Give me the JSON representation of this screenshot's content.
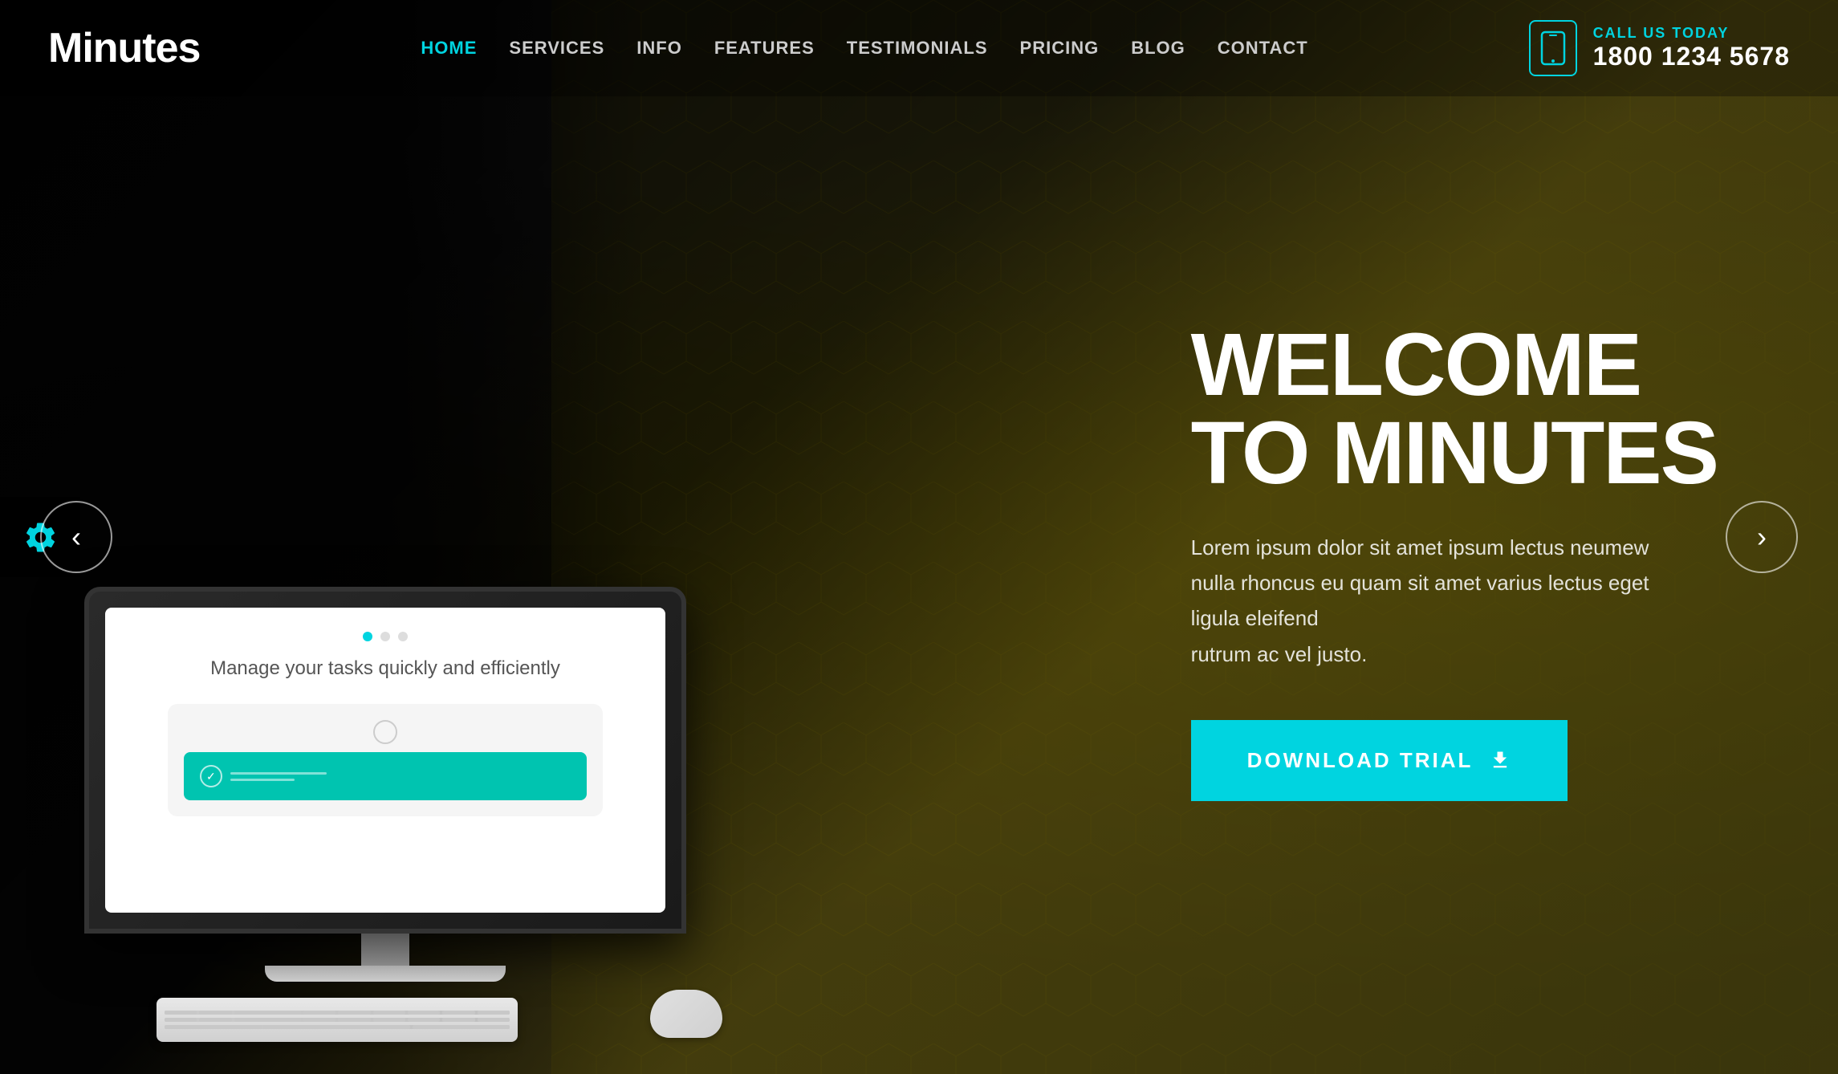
{
  "brand": {
    "logo": "Minutes"
  },
  "nav": {
    "items": [
      {
        "label": "HOME",
        "active": true
      },
      {
        "label": "SERVICES",
        "active": false
      },
      {
        "label": "INFO",
        "active": false
      },
      {
        "label": "FEATURES",
        "active": false
      },
      {
        "label": "TESTIMONIALS",
        "active": false
      },
      {
        "label": "PRICING",
        "active": false
      },
      {
        "label": "BLOG",
        "active": false
      },
      {
        "label": "CONTACT",
        "active": false
      }
    ]
  },
  "call": {
    "label": "CALL US TODAY",
    "number": "1800 1234 5678"
  },
  "hero": {
    "title_line1": "WELCOME",
    "title_line2": "TO MINUTES",
    "description": "Lorem ipsum dolor sit amet ipsum lectus neumew nulla rhoncus eu quam sit amet varius lectus eget ligula eleifend\nrutrum ac vel justo.",
    "cta_label": "DOWNLOAD TRIAL"
  },
  "screen": {
    "text": "Manage your tasks quickly\nand efficiently"
  },
  "arrows": {
    "prev": "‹",
    "next": "›"
  }
}
